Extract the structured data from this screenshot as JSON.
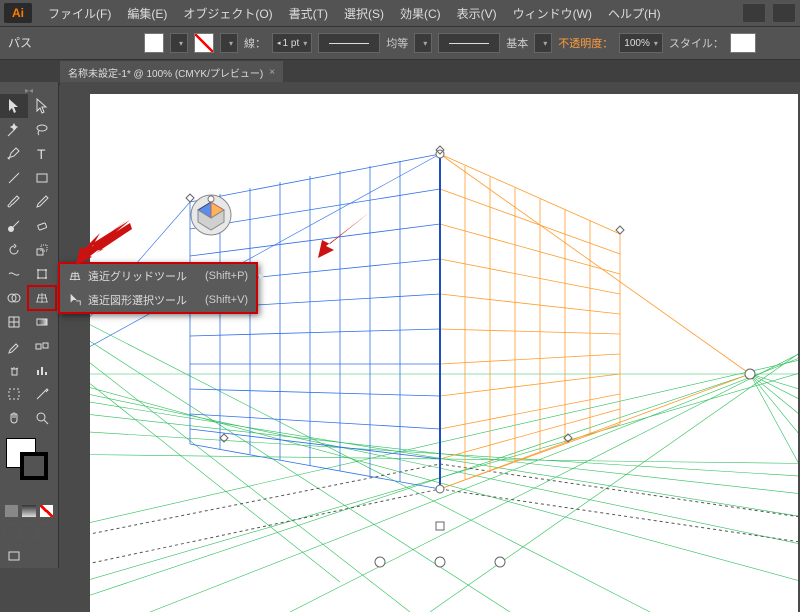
{
  "app_logo": "Ai",
  "menu": {
    "file": "ファイル(F)",
    "edit": "編集(E)",
    "object": "オブジェクト(O)",
    "type": "書式(T)",
    "select": "選択(S)",
    "effect": "効果(C)",
    "view": "表示(V)",
    "window": "ウィンドウ(W)",
    "help": "ヘルプ(H)"
  },
  "controlbar": {
    "path": "パス",
    "stroke_label": "線：",
    "stroke_weight": "1 pt",
    "dash": "均等",
    "profile": "基本",
    "opacity_label": "不透明度：",
    "opacity": "100%",
    "style_label": "スタイル："
  },
  "tab": {
    "title": "名称未設定-1* @ 100% (CMYK/プレビュー)"
  },
  "flyout": {
    "items": [
      {
        "icon": "grid",
        "label": "遠近グリッドツール",
        "shortcut": "(Shift+P)"
      },
      {
        "icon": "select",
        "label": "遠近図形選択ツール",
        "shortcut": "(Shift+V)"
      }
    ]
  }
}
